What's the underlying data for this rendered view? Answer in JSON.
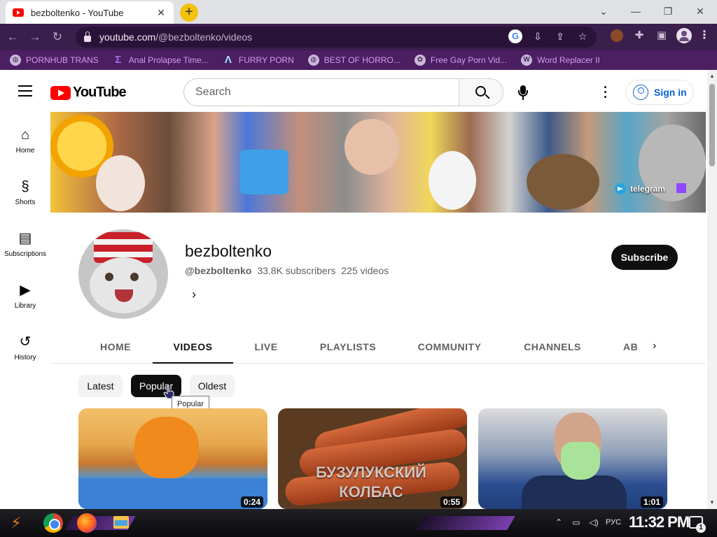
{
  "browser": {
    "tab_title": "bezboltenko - YouTube",
    "tab_close": "✕",
    "new_tab": "+",
    "url_host": "youtube.com",
    "url_path": "/@bezboltenko/videos",
    "window_controls": {
      "minimize": "—",
      "restore": "❐",
      "close": "✕",
      "tab_search": "⌄"
    },
    "accent_color": "#3a1e4c",
    "bookmarks": [
      {
        "label": "PORNHUB TRANS",
        "icon": "globe-icon"
      },
      {
        "label": "Anal Prolapse Time...",
        "icon": "bookmark-s-icon"
      },
      {
        "label": "FURRY PORN",
        "icon": "triangle-icon"
      },
      {
        "label": "BEST OF HORRO...",
        "icon": "globe-icon"
      },
      {
        "label": "Free Gay Porn Vid...",
        "icon": "gear-icon"
      },
      {
        "label": "Word Replacer II",
        "icon": "wr-icon"
      }
    ]
  },
  "youtube": {
    "logo_text": "YouTube",
    "search_placeholder": "Search",
    "sign_in": "Sign in",
    "guide": [
      {
        "label": "Home",
        "icon": "home-icon"
      },
      {
        "label": "Shorts",
        "icon": "shorts-icon"
      },
      {
        "label": "Subscriptions",
        "icon": "subscriptions-icon"
      },
      {
        "label": "Library",
        "icon": "library-icon"
      },
      {
        "label": "History",
        "icon": "history-icon"
      }
    ],
    "banner_link": "telegram",
    "channel": {
      "name": "bezboltenko",
      "handle": "@bezboltenko",
      "subscribers": "33.8K subscribers",
      "videos": "225 videos",
      "subscribe": "Subscribe"
    },
    "tabs": [
      {
        "label": "HOME",
        "active": false
      },
      {
        "label": "VIDEOS",
        "active": true
      },
      {
        "label": "LIVE",
        "active": false
      },
      {
        "label": "PLAYLISTS",
        "active": false
      },
      {
        "label": "COMMUNITY",
        "active": false
      },
      {
        "label": "CHANNELS",
        "active": false
      },
      {
        "label": "ABOUT",
        "active": false
      }
    ],
    "chips": [
      {
        "label": "Latest",
        "active": false
      },
      {
        "label": "Popular",
        "active": true
      },
      {
        "label": "Oldest",
        "active": false
      }
    ],
    "tooltip": "Popular",
    "videos": [
      {
        "duration": "0:24",
        "caption": ""
      },
      {
        "duration": "0:55",
        "caption_line1": "БУЗУЛУКСКИЙ",
        "caption_line2": "КОЛБАС"
      },
      {
        "duration": "1:01",
        "caption": ""
      }
    ]
  },
  "taskbar": {
    "language": "РУС",
    "clock": "11:32 PM",
    "notification_count": "1"
  }
}
